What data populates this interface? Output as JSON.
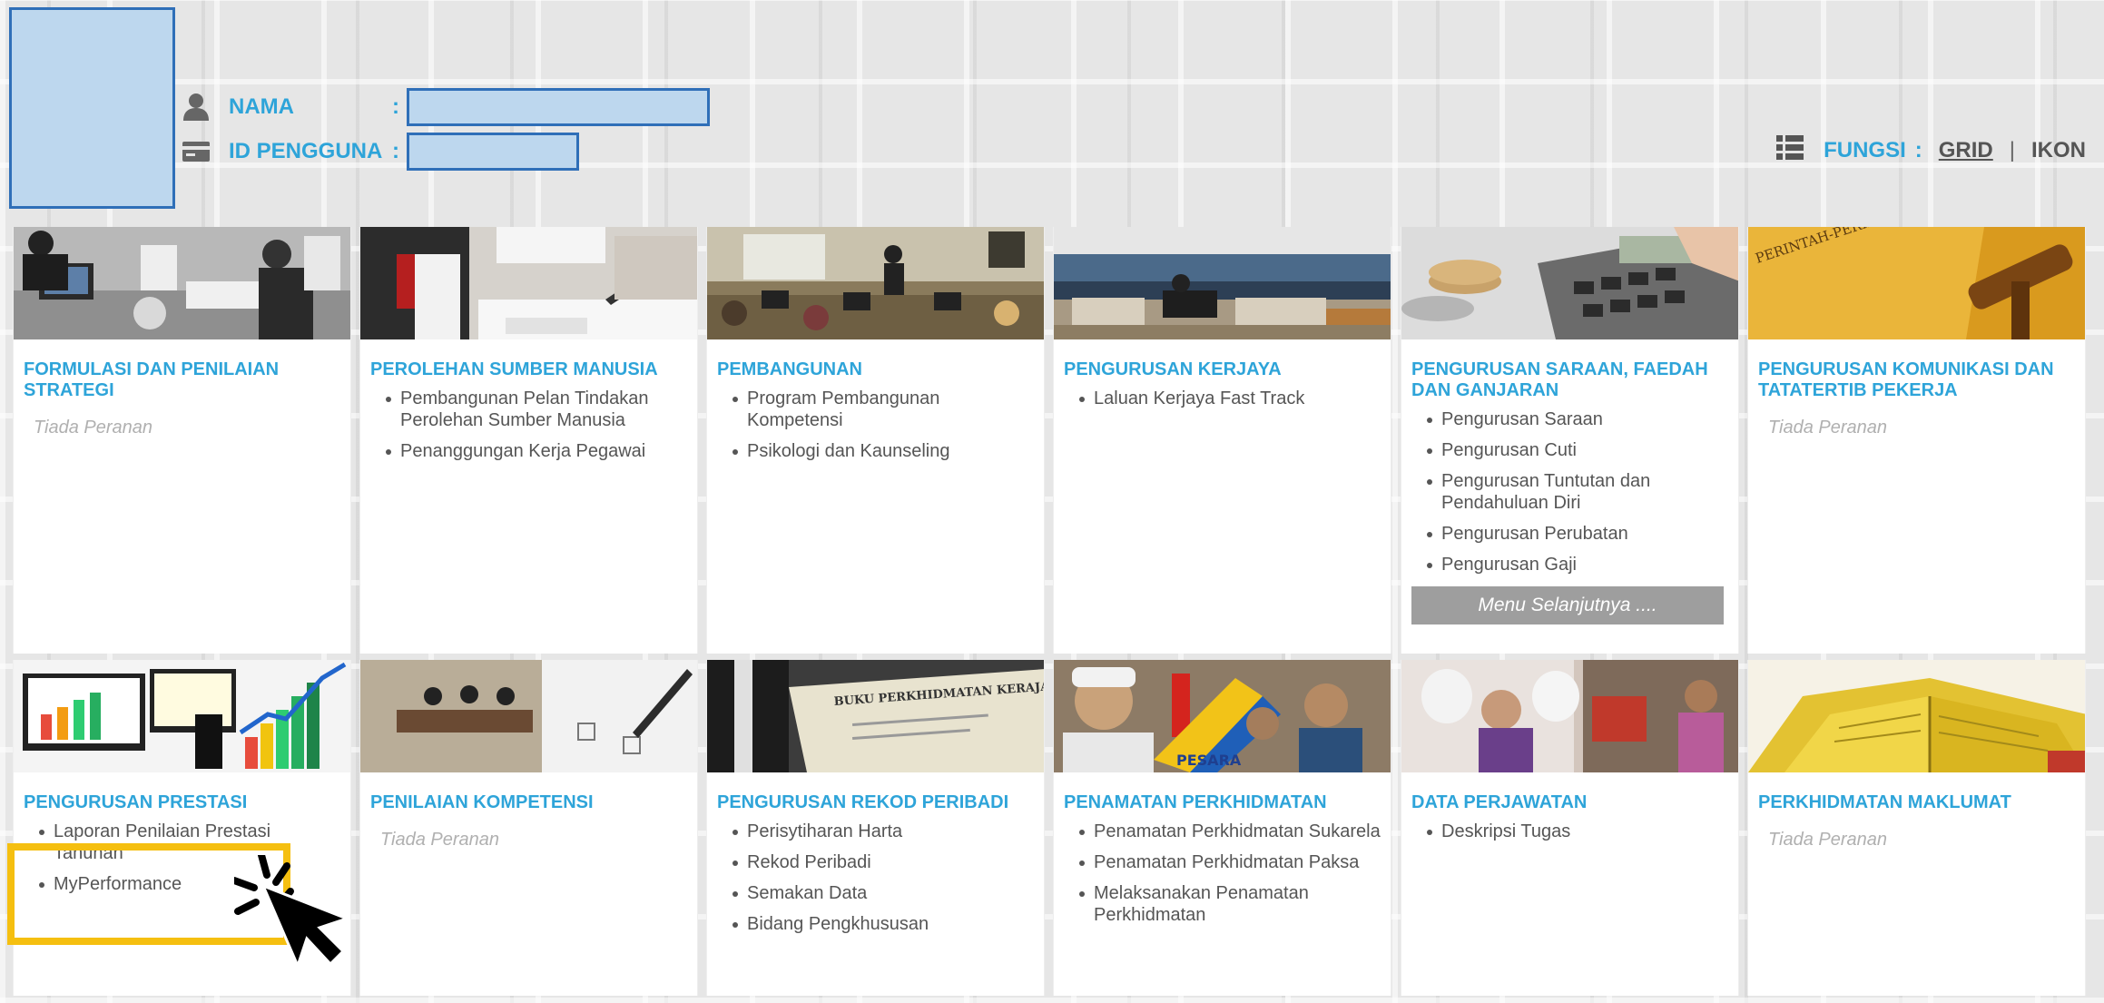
{
  "header": {
    "nama_label": "NAMA",
    "id_label": "ID PENGGUNA",
    "colon": ":",
    "fungsi_label": "FUNGSI",
    "grid_label": "GRID",
    "separator": "|",
    "ikon_label": "IKON"
  },
  "icons": {
    "user": "user-icon",
    "card": "id-card-icon",
    "list": "list-icon"
  },
  "colors": {
    "accent": "#2ea4d9",
    "highlight": "#f5bf10",
    "redacted_fill": "#bdd7ee",
    "redacted_border": "#2f6fb8"
  },
  "tiles": [
    {
      "title": "FORMULASI DAN PENILAIAN STRATEGI",
      "none": "Tiada Peranan"
    },
    {
      "title": "PEROLEHAN SUMBER MANUSIA",
      "items": [
        "Pembangunan Pelan Tindakan Perolehan Sumber Manusia",
        "Penanggungan Kerja Pegawai"
      ]
    },
    {
      "title": "PEMBANGUNAN",
      "items": [
        "Program Pembangunan Kompetensi",
        "Psikologi dan Kaunseling"
      ]
    },
    {
      "title": "PENGURUSAN KERJAYA",
      "items": [
        "Laluan Kerjaya Fast Track"
      ]
    },
    {
      "title": "PENGURUSAN SARAAN, FAEDAH DAN GANJARAN",
      "items": [
        "Pengurusan Saraan",
        "Pengurusan Cuti",
        "Pengurusan Tuntutan dan Pendahuluan Diri",
        "Pengurusan Perubatan",
        "Pengurusan Gaji"
      ],
      "button": "Menu Selanjutnya ...."
    },
    {
      "title": "PENGURUSAN KOMUNIKASI DAN TATATERTIB PEKERJA",
      "none": "Tiada Peranan"
    },
    {
      "title": "PENGURUSAN PRESTASI",
      "items": [
        "Laporan Penilaian Prestasi Tahunan",
        "MyPerformance"
      ]
    },
    {
      "title": "PENILAIAN KOMPETENSI",
      "none": "Tiada Peranan"
    },
    {
      "title": "PENGURUSAN REKOD PERIBADI",
      "items": [
        "Perisytiharan Harta",
        "Rekod Peribadi",
        "Semakan Data",
        "Bidang Pengkhususan"
      ]
    },
    {
      "title": "PENAMATAN PERKHIDMATAN",
      "items": [
        "Penamatan Perkhidmatan Sukarela",
        "Penamatan Perkhidmatan Paksa",
        "Melaksanakan Penamatan Perkhidmatan"
      ]
    },
    {
      "title": "DATA PERJAWATAN",
      "items": [
        "Deskripsi Tugas"
      ]
    },
    {
      "title": "PERKHIDMATAN MAKLUMAT",
      "none": "Tiada Peranan"
    }
  ],
  "images": {
    "t8_doc_text": "BUKU PERKHIDMATAN KERAJAAN",
    "t10_logo_text": "PESARA",
    "t6_doc_text": "PERINTAH-PERINTAH AM DAN ARAHAN PENTADBIRAN"
  }
}
